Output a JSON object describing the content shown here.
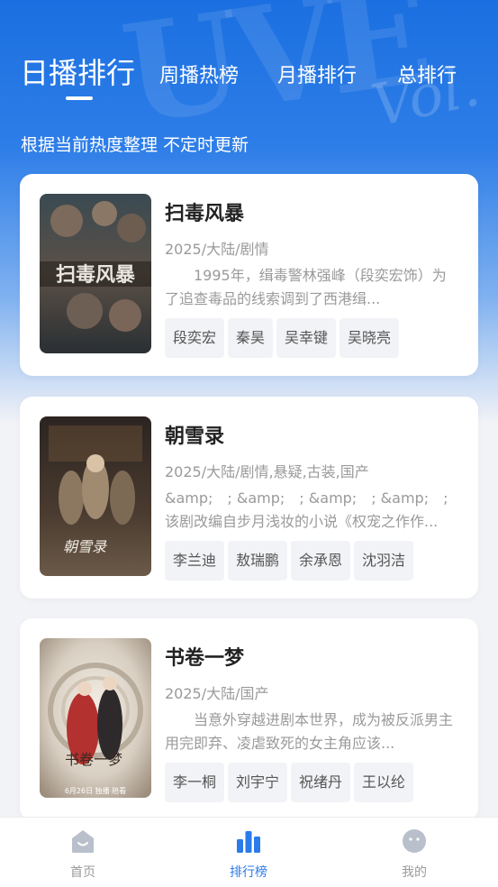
{
  "header": {
    "tabs": [
      {
        "label": "日播排行",
        "active": true
      },
      {
        "label": "周播热榜",
        "active": false
      },
      {
        "label": "月播排行",
        "active": false
      },
      {
        "label": "总排行",
        "active": false
      }
    ],
    "subtitle": "根据当前热度整理 不定时更新"
  },
  "dramas": [
    {
      "title": "扫毒风暴",
      "meta": "2025/大陆/剧情",
      "description": "1995年，缉毒警林强峰（段奕宏饰）为了追查毒品的线索调到了西港缉...",
      "cast": [
        "段奕宏",
        "秦昊",
        "吴幸键",
        "吴晓亮"
      ],
      "poster_text": "扫毒风暴"
    },
    {
      "title": "朝雪录",
      "meta": "2025/大陆/剧情,悬疑,古装,国产",
      "description": "&amp;　; &amp;　; &amp;　; &amp;　;该剧改编自步月浅妆的小说《权宠之作作...",
      "cast": [
        "李兰迪",
        "敖瑞鹏",
        "余承恩",
        "沈羽洁"
      ],
      "poster_text": "朝雪录"
    },
    {
      "title": "书卷一梦",
      "meta": "2025/大陆/国产",
      "description": "当意外穿越进剧本世界，成为被反派男主用完即弃、凌虐致死的女主角应该...",
      "cast": [
        "李一桐",
        "刘宇宁",
        "祝绪丹",
        "王以纶"
      ],
      "poster_text": "书卷一梦",
      "poster_caption": "6月26日 独播 陪看"
    }
  ],
  "tabbar": [
    {
      "label": "首页",
      "icon": "home-icon",
      "active": false
    },
    {
      "label": "排行榜",
      "icon": "ranking-icon",
      "active": true
    },
    {
      "label": "我的",
      "icon": "profile-icon",
      "active": false
    }
  ],
  "colors": {
    "accent": "#2b7bea",
    "header_blue": "#1b6fe0",
    "background": "#f2f3f7"
  }
}
